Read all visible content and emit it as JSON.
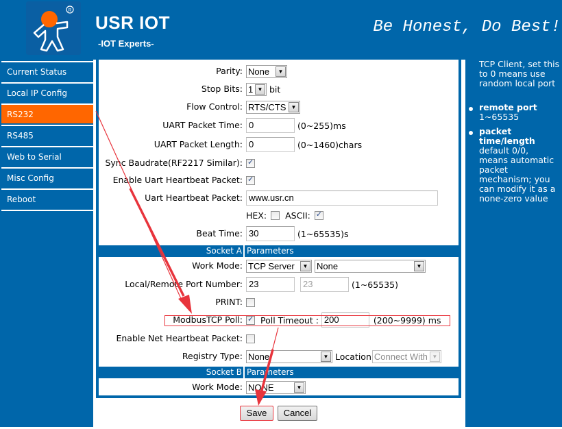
{
  "header": {
    "brand_title": "USR IOT",
    "brand_subtitle": "-IOT Experts-",
    "slogan": "Be Honest, Do Best!",
    "logo_icon": "running-man-logo-icon"
  },
  "sidebar": {
    "items": [
      {
        "label": "Current Status",
        "active": false
      },
      {
        "label": "Local IP Config",
        "active": false
      },
      {
        "label": "RS232",
        "active": true
      },
      {
        "label": "RS485",
        "active": false
      },
      {
        "label": "Web to Serial",
        "active": false
      },
      {
        "label": "Misc Config",
        "active": false
      },
      {
        "label": "Reboot",
        "active": false
      }
    ]
  },
  "form": {
    "parity": {
      "label": "Parity:",
      "value": "None"
    },
    "stop_bits": {
      "label": "Stop Bits:",
      "value": "1",
      "unit": "bit"
    },
    "flow_control": {
      "label": "Flow Control:",
      "value": "RTS/CTS"
    },
    "uart_packet_time": {
      "label": "UART Packet Time:",
      "value": "0",
      "hint": "(0~255)ms"
    },
    "uart_packet_length": {
      "label": "UART Packet Length:",
      "value": "0",
      "hint": "(0~1460)chars"
    },
    "sync_baudrate": {
      "label": "Sync Baudrate(RF2217 Similar):",
      "checked": true
    },
    "enable_uart_heartbeat": {
      "label": "Enable Uart Heartbeat Packet:",
      "checked": true
    },
    "uart_heartbeat_packet": {
      "label": "Uart Heartbeat Packet:",
      "value": "www.usr.cn"
    },
    "hex": {
      "label": "HEX:",
      "checked": false
    },
    "ascii": {
      "label": "ASCII:",
      "checked": true
    },
    "beat_time": {
      "label": "Beat Time:",
      "value": "30",
      "hint": "(1~65535)s"
    },
    "socket_a": {
      "header_left": "Socket A",
      "header_right": "Parameters",
      "work_mode": {
        "label": "Work Mode:",
        "value": "TCP Server",
        "secondary_value": "None"
      },
      "port_number": {
        "label": "Local/Remote Port Number:",
        "local_value": "23",
        "remote_value": "23",
        "hint": "(1~65535)"
      },
      "print": {
        "label": "PRINT:",
        "checked": false
      },
      "modbus_tcp_poll": {
        "label": "ModbusTCP Poll:",
        "checked": true
      },
      "poll_timeout": {
        "label": "Poll Timeout :",
        "value": "200",
        "hint": "(200~9999) ms"
      },
      "enable_net_heartbeat": {
        "label": "Enable Net Heartbeat Packet:",
        "checked": false
      },
      "registry_type": {
        "label": "Registry Type:",
        "value": "None",
        "location_label": "Location",
        "location_value": "Connect With"
      }
    },
    "socket_b": {
      "header_left": "Socket B",
      "header_right": "Parameters",
      "work_mode": {
        "label": "Work Mode:",
        "value": "NONE"
      }
    }
  },
  "buttons": {
    "save": "Save",
    "cancel": "Cancel"
  },
  "help": {
    "partial_text": "TCP Client, set this to 0 means use random local port",
    "items": [
      {
        "title": "remote port",
        "text": "1~65535"
      },
      {
        "title": "packet time/length",
        "text": "default 0/0, means automatic packet mechanism; you can modify it as a none-zero value"
      }
    ]
  },
  "annotations": {
    "arrow_color": "#e8343c",
    "highlight_color": "#e8343c"
  }
}
